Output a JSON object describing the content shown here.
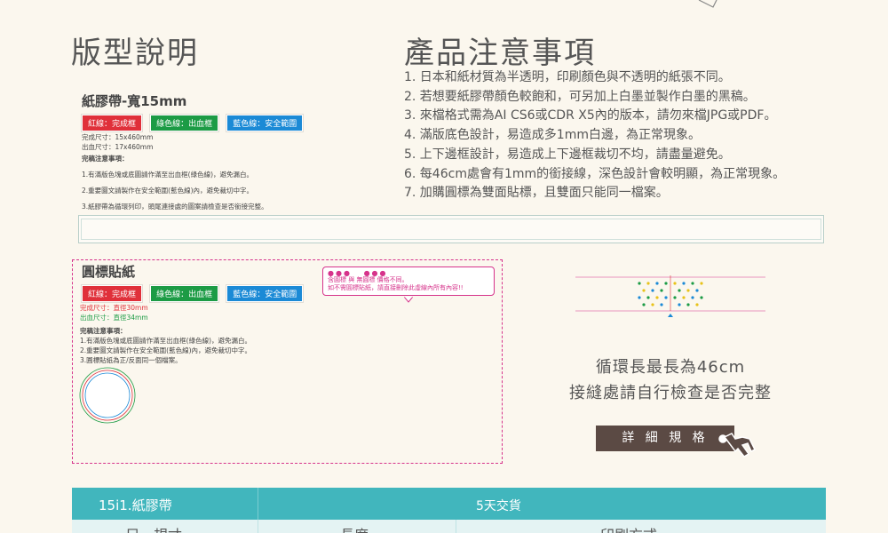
{
  "left_section": {
    "title": "版型說明",
    "tape_heading": "紙膠帶-寬15mm",
    "legend": {
      "red": "紅線：完成框",
      "green": "綠色線：出血框",
      "blue": "藍色線：安全範圍"
    },
    "tape_sizes": [
      "完成尺寸：15x460mm",
      "出血尺寸：17x460mm"
    ],
    "tape_notes_title": "完稿注意事項：",
    "tape_notes": [
      "1.有滿版色塊或底圖請作滿至出血框(綠色線)，避免漏白。",
      "2.重要圖文請製作在安全範圍(藍色線)內，避免裁切中字。",
      "3.紙膠帶為循環列印，頭尾連接處的圖案請檢查是否銜接完整。"
    ]
  },
  "right_section": {
    "title": "產品注意事項",
    "notes": [
      "1. 日本和紙材質為半透明，印刷顏色與不透明的紙張不同。",
      "2. 若想要紙膠帶顏色較飽和，可另加上白墨並製作白墨的黑稿。",
      "3. 來檔格式需為AI CS6或CDR X5內的版本，請勿來檔JPG或PDF。",
      "4. 滿版底色設計，易造成多1mm白邊，為正常現象。",
      "5. 上下邊框設計，易造成上下邊框裁切不均，請盡量避免。",
      "6. 每46cm處會有1mm的銜接線，深色設計會較明顯，為正常現象。",
      "7. 加購圓標為雙面貼標，且雙面只能同一檔案。"
    ]
  },
  "sticker_section": {
    "heading": "圓標貼紙",
    "legend": {
      "red": "紅線：完成框",
      "green": "綠色線：出血框",
      "blue": "藍色線：安全範圍"
    },
    "size_finished": "完成尺寸：直徑30mm",
    "size_bleed": "出血尺寸：直徑34mm",
    "notes_title": "完稿注意事項：",
    "notes": [
      "1.有滿版色塊或底圖請作滿至出血框(綠色線)，避免漏白。",
      "2.重要圖文請製作在安全範圍(藍色線)內，避免裁切中字。",
      "3.圓標貼紙為正/反面同一個檔案。"
    ],
    "tip_line1": "含圓標 與 無圓標 價格不同。",
    "tip_line2": "如不需圓標貼紙，請直接刪除此虛線內所有內容!!"
  },
  "loop_panel": {
    "line1": "循環長最長為46cm",
    "line2": "接縫處請自行檢查是否完整",
    "button_label": "詳 細 規 格",
    "icon": "hand-pointer-icon"
  },
  "table": {
    "col1": "15i1.紙膠帶",
    "col2": "5天交貨",
    "sub1": "尺　規寸",
    "sub2": "長度",
    "sub3": "印刷方式"
  },
  "colors": {
    "accent_teal": "#41b6bd",
    "red": "#e0303a",
    "green": "#1c9b45",
    "blue": "#1b8ad6",
    "magenta": "#d6338b",
    "button_brown": "#5b4a44"
  }
}
